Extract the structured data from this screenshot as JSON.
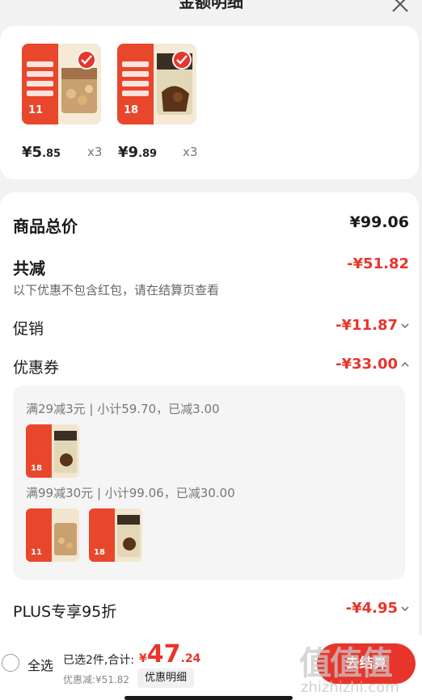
{
  "sheet": {
    "title": "金额明细"
  },
  "products": [
    {
      "price_int": "¥5",
      "price_dec": ".85",
      "qty": "x3",
      "label_num": "11",
      "selected": true
    },
    {
      "price_int": "¥9",
      "price_dec": ".89",
      "qty": "x3",
      "label_num": "18",
      "selected": true
    }
  ],
  "summary": {
    "total_label": "商品总价",
    "total_value": "¥99.06",
    "reduce_label": "共减",
    "reduce_value": "-¥51.82",
    "hint": "以下优惠不包含红包，请在结算页查看",
    "promo_label": "促销",
    "promo_value": "-¥11.87",
    "coupon_label": "优惠券",
    "coupon_value": "-¥33.00",
    "plus_label": "PLUS专享95折",
    "plus_value": "-¥4.95"
  },
  "coupons": [
    {
      "rule": "满29减3元 | 小计59.70，已减3.00",
      "thumbs": [
        "18"
      ]
    },
    {
      "rule": "满99减30元 | 小计99.06，已减30.00",
      "thumbs": [
        "11",
        "18"
      ]
    }
  ],
  "bottom": {
    "select_all": "全选",
    "selected_info": "已选2件,合计:",
    "total_sym": "¥",
    "total_int": "47",
    "total_dec": ".24",
    "discount": "优惠减:¥51.82",
    "detail_button": "优惠明细",
    "checkout_button": "去结算"
  },
  "watermark": {
    "text": "zhizhizhi.com"
  },
  "colors": {
    "accent": "#e8352b",
    "card": "#ffffff",
    "background": "#f2f2f2"
  }
}
